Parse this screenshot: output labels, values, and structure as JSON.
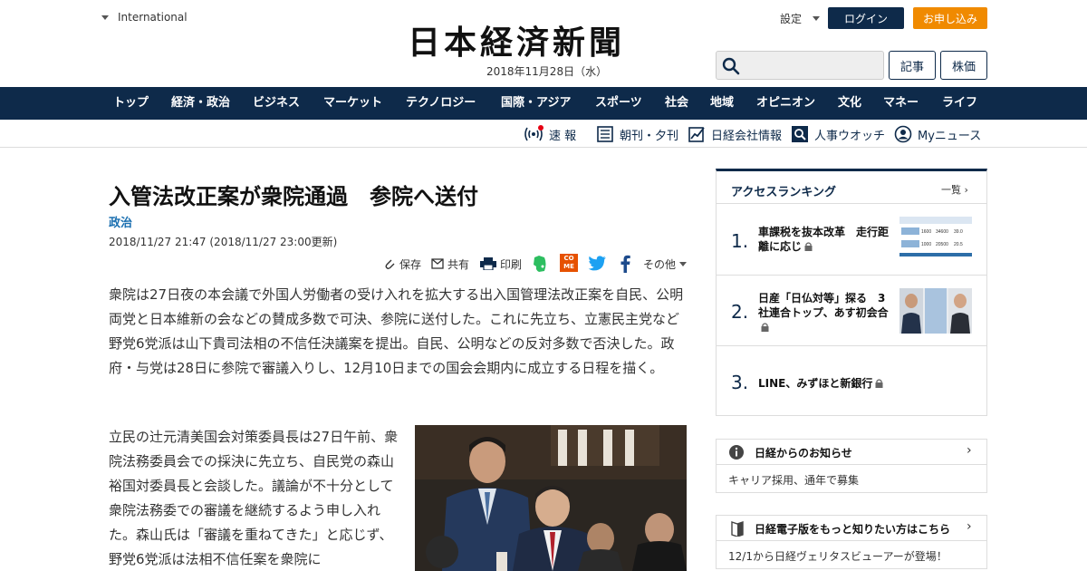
{
  "header": {
    "region": "International",
    "logo": "日本経済新聞",
    "date": "2018年11月28日（水）",
    "settings": "設定",
    "login": "ログイン",
    "apply": "お申し込み",
    "search_placeholder": "",
    "btn_articles": "記事",
    "btn_stocks": "株価"
  },
  "nav": [
    "トップ",
    "経済・政治",
    "ビジネス",
    "マーケット",
    "テクノロジー",
    "国際・アジア",
    "スポーツ",
    "社会",
    "地域",
    "オピニオン",
    "文化",
    "マネー",
    "ライフ"
  ],
  "subnav": {
    "flash": "速 報",
    "paper": "朝刊・夕刊",
    "company": "日経会社情報",
    "people": "人事ウオッチ",
    "mynews": "Myニュース"
  },
  "article": {
    "title": "入管法改正案が衆院通過　参院へ送付",
    "category": "政治",
    "date": "2018/11/27 21:47 (2018/11/27 23:00更新)",
    "share": {
      "save": "保存",
      "share": "共有",
      "print": "印刷",
      "comeme": "CO ME",
      "more": "その他"
    },
    "lead": "衆院は27日夜の本会議で外国人労働者の受け入れを拡大する出入国管理法改正案を自民、公明両党と日本維新の会などの賛成多数で可決、参院に送付した。これに先立ち、立憲民主党など野党6党派は山下貴司法相の不信任決議案を提出。自民、公明などの反対多数で否決した。政府・与党は28日に参院で審議入りし、12月10日までの国会会期内に成立する日程を描く。",
    "body2": "立民の辻元清美国会対策委員長は27日午前、衆院法務委員会での採決に先立ち、自民党の森山裕国対委員長と会談した。議論が不十分として衆院法務委での審議を継続するよう申し入れた。森山氏は「審議を重ねてきた」と応じず、野党6党派は法相不信任案を衆院に"
  },
  "ranking": {
    "title": "アクセスランキング",
    "more": "一覧",
    "items": [
      {
        "num": "1.",
        "text": "車課税を抜本改革　走行距離に応じ"
      },
      {
        "num": "2.",
        "text": "日産「日仏対等」探る　3社連合トップ、あす初会合"
      },
      {
        "num": "3.",
        "text": "LINE、みずほと新銀行"
      }
    ],
    "thumb1": {
      "r1": [
        "1600",
        "34600",
        "39.0"
      ],
      "r2": [
        "1000",
        "20500",
        "20.5"
      ]
    }
  },
  "notices": [
    {
      "title": "日経からのお知らせ",
      "body": "キャリア採用、通年で募集"
    },
    {
      "title": "日経電子版をもっと知りたい方はこちら",
      "body": "12/1から日経ヴェリタスビューアーが登場！"
    }
  ],
  "colors": {
    "navy": "#0e2a4a",
    "orange": "#f08a00",
    "link": "#1a6fb0"
  }
}
